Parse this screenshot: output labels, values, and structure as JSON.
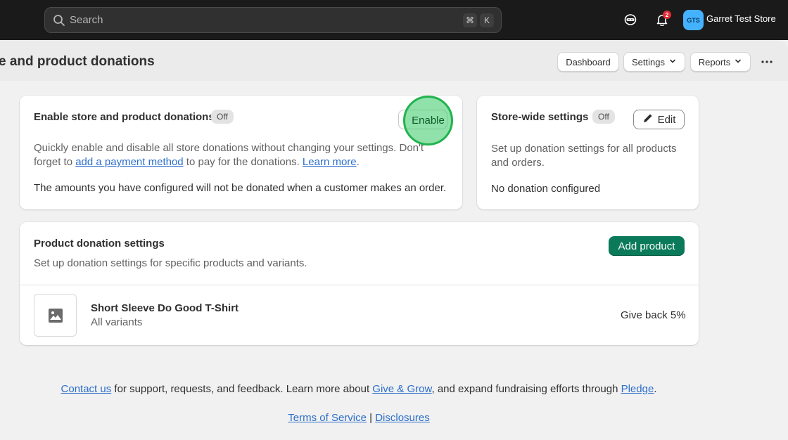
{
  "topbar": {
    "search_placeholder": "Search",
    "shortcut_cmd": "⌘",
    "shortcut_key": "K",
    "notifications_count": "2",
    "avatar_initials": "GTS",
    "store_name": "Garret Test Store"
  },
  "header": {
    "title": "e and product donations",
    "buttons": {
      "dashboard": "Dashboard",
      "settings": "Settings",
      "reports": "Reports"
    }
  },
  "donations_card": {
    "title": "Enable store and product donations",
    "status": "Off",
    "enable_label": "Enable",
    "desc_part1": "Quickly enable and disable all store donations without changing your settings. Don't forget to ",
    "payment_link": "add a payment method",
    "desc_part2": " to pay for the donations. ",
    "learn_more": "Learn more",
    "desc_end": ".",
    "note": "The amounts you have configured will not be donated when a customer makes an order."
  },
  "storewide_card": {
    "title": "Store-wide settings",
    "status": "Off",
    "edit_label": "Edit",
    "description": "Set up donation settings for all products and orders.",
    "status_text": "No donation configured"
  },
  "product_card": {
    "title": "Product donation settings",
    "description": "Set up donation settings for specific products and variants.",
    "add_label": "Add product",
    "items": [
      {
        "name": "Short Sleeve Do Good T-Shirt",
        "variants": "All variants",
        "give_back": "Give back 5%"
      }
    ]
  },
  "footer": {
    "contact_link": "Contact us",
    "text1": " for support, requests, and feedback. Learn more about ",
    "give_grow_link": "Give & Grow",
    "text2": ", and expand fundraising efforts through ",
    "pledge_link": "Pledge",
    "text3": ".",
    "terms_link": "Terms of Service",
    "separator": " | ",
    "disclosures_link": "Disclosures"
  },
  "colors": {
    "primary_button": "#0b7a5a",
    "link": "#2c6ecb",
    "topbar": "#1a1a1a",
    "click_indicator": "#22b34f"
  }
}
